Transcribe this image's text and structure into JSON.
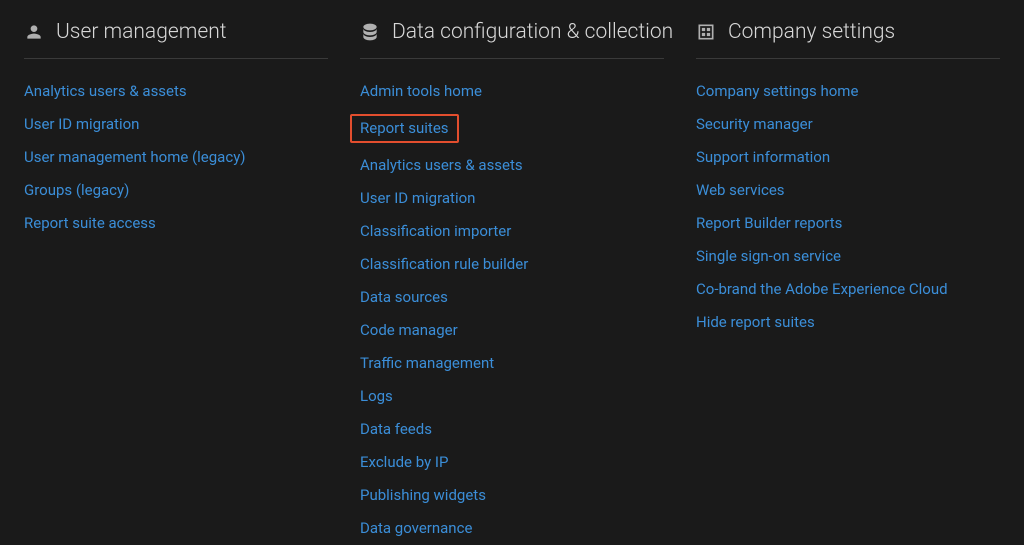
{
  "columns": [
    {
      "id": "user-management",
      "icon": "user",
      "title": "User management",
      "links": [
        {
          "label": "Analytics users & assets",
          "highlighted": false
        },
        {
          "label": "User ID migration",
          "highlighted": false
        },
        {
          "label": "User management home (legacy)",
          "highlighted": false
        },
        {
          "label": "Groups (legacy)",
          "highlighted": false
        },
        {
          "label": "Report suite access",
          "highlighted": false
        }
      ]
    },
    {
      "id": "data-configuration",
      "icon": "database",
      "title": "Data configuration & collection",
      "links": [
        {
          "label": "Admin tools home",
          "highlighted": false
        },
        {
          "label": "Report suites",
          "highlighted": true
        },
        {
          "label": "Analytics users & assets",
          "highlighted": false
        },
        {
          "label": "User ID migration",
          "highlighted": false
        },
        {
          "label": "Classification importer",
          "highlighted": false
        },
        {
          "label": "Classification rule builder",
          "highlighted": false
        },
        {
          "label": "Data sources",
          "highlighted": false
        },
        {
          "label": "Code manager",
          "highlighted": false
        },
        {
          "label": "Traffic management",
          "highlighted": false
        },
        {
          "label": "Logs",
          "highlighted": false
        },
        {
          "label": "Data feeds",
          "highlighted": false
        },
        {
          "label": "Exclude by IP",
          "highlighted": false
        },
        {
          "label": "Publishing widgets",
          "highlighted": false
        },
        {
          "label": "Data governance",
          "highlighted": false
        }
      ]
    },
    {
      "id": "company-settings",
      "icon": "building",
      "title": "Company settings",
      "links": [
        {
          "label": "Company settings home",
          "highlighted": false
        },
        {
          "label": "Security manager",
          "highlighted": false
        },
        {
          "label": "Support information",
          "highlighted": false
        },
        {
          "label": "Web services",
          "highlighted": false
        },
        {
          "label": "Report Builder reports",
          "highlighted": false
        },
        {
          "label": "Single sign-on service",
          "highlighted": false
        },
        {
          "label": "Co-brand the Adobe Experience Cloud",
          "highlighted": false
        },
        {
          "label": "Hide report suites",
          "highlighted": false
        }
      ]
    }
  ]
}
